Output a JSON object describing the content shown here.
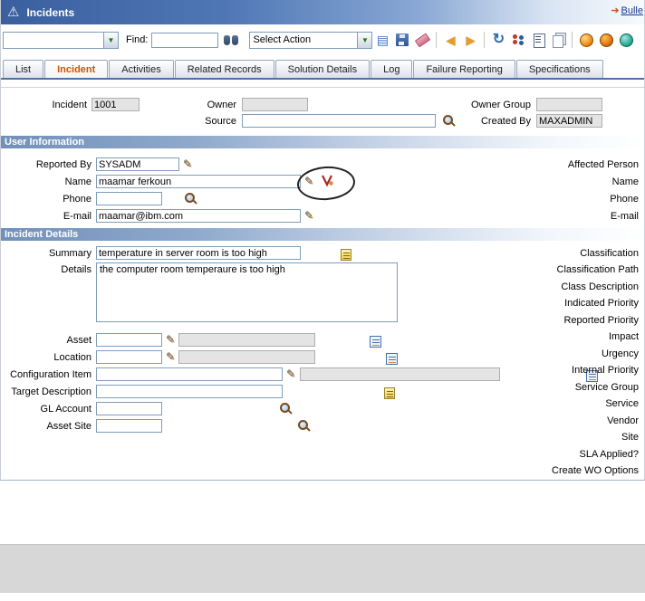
{
  "window": {
    "title": "Incidents",
    "bulletins_link": "Bulle"
  },
  "toolbar": {
    "query_value": "",
    "find_label": "Find:",
    "find_value": "",
    "action_value": "Select Action",
    "icons": [
      "insert-new-record-icon",
      "save-record-icon",
      "clear-changes-icon",
      "previous-record-icon",
      "next-record-icon",
      "change-status-icon",
      "select-owner-icon",
      "create-communication-icon",
      "run-reports-icon",
      "start-timer-icon",
      "stop-timer-icon",
      "help-icon"
    ]
  },
  "tabs": {
    "active": "Incident",
    "items": [
      {
        "label": "List"
      },
      {
        "label": "Incident"
      },
      {
        "label": "Activities"
      },
      {
        "label": "Related Records"
      },
      {
        "label": "Solution Details"
      },
      {
        "label": "Log"
      },
      {
        "label": "Failure Reporting"
      },
      {
        "label": "Specifications"
      }
    ]
  },
  "record_header": {
    "incident": {
      "label": "Incident",
      "value": "1001"
    },
    "owner": {
      "label": "Owner",
      "value": ""
    },
    "owner_group": {
      "label": "Owner Group",
      "value": ""
    },
    "source": {
      "label": "Source",
      "value": ""
    },
    "created_by": {
      "label": "Created By",
      "value": "MAXADMIN"
    }
  },
  "user_information": {
    "title": "User Information",
    "reported_by": {
      "label": "Reported By",
      "value": "SYSADM"
    },
    "name": {
      "label": "Name",
      "value": "maamar ferkoun"
    },
    "phone": {
      "label": "Phone",
      "value": ""
    },
    "email": {
      "label": "E-mail",
      "value": "maamar@ibm.com"
    },
    "right_labels": [
      "Affected Person",
      "Name",
      "Phone",
      "E-mail"
    ]
  },
  "incident_details": {
    "title": "Incident Details",
    "summary": {
      "label": "Summary",
      "value": "temperature in server room is too high"
    },
    "details": {
      "label": "Details",
      "value": "the computer room temperaure is too high"
    },
    "asset": {
      "label": "Asset",
      "value": "",
      "description": ""
    },
    "location": {
      "label": "Location",
      "value": "",
      "description": ""
    },
    "configuration_item": {
      "label": "Configuration Item",
      "value": "",
      "description": ""
    },
    "target_description": {
      "label": "Target Description",
      "value": ""
    },
    "gl_account": {
      "label": "GL Account",
      "value": ""
    },
    "asset_site": {
      "label": "Asset Site",
      "value": ""
    },
    "right_labels": [
      "Classification",
      "Classification Path",
      "Class Description",
      "Indicated Priority",
      "Reported Priority",
      "Impact",
      "Urgency",
      "Internal Priority",
      "Service Group",
      "Service",
      "Vendor",
      "Site",
      "SLA Applied?",
      "Create WO Options"
    ]
  }
}
